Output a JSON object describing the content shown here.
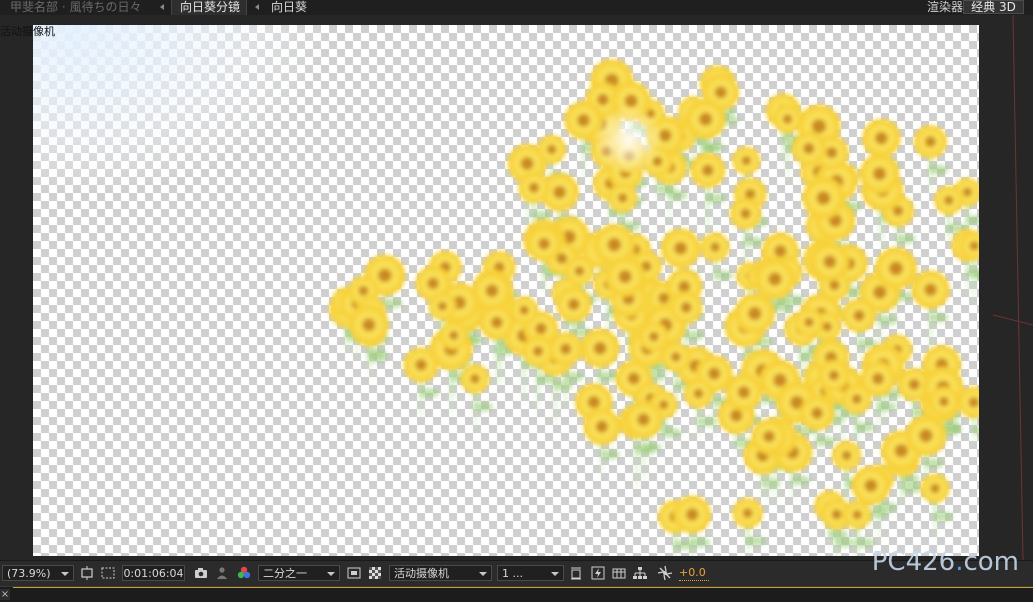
{
  "breadcrumb": {
    "parent": "甲斐名部 · 風待ちの日々",
    "active": "向日葵分镜",
    "child": "向日葵"
  },
  "renderer": {
    "label": "渲染器:",
    "value": "经典 3D"
  },
  "viewport": {
    "camera_label": "活动摄像机"
  },
  "toolbar": {
    "zoom": "(73.9%)",
    "timecode": "0:01:06:04",
    "resolution": "二分之一",
    "view": "活动摄像机",
    "views_count": "1 ...",
    "exposure": "+0.0"
  },
  "watermark": {
    "prefix": "PC",
    "num": "426",
    "dot": ".",
    "suffix": "com"
  },
  "bottom": {
    "close": "×"
  },
  "colors": {
    "accent_exposure": "#e9a43c",
    "sunflower": "#f7d23a",
    "leaf": "#9ccf7c"
  }
}
